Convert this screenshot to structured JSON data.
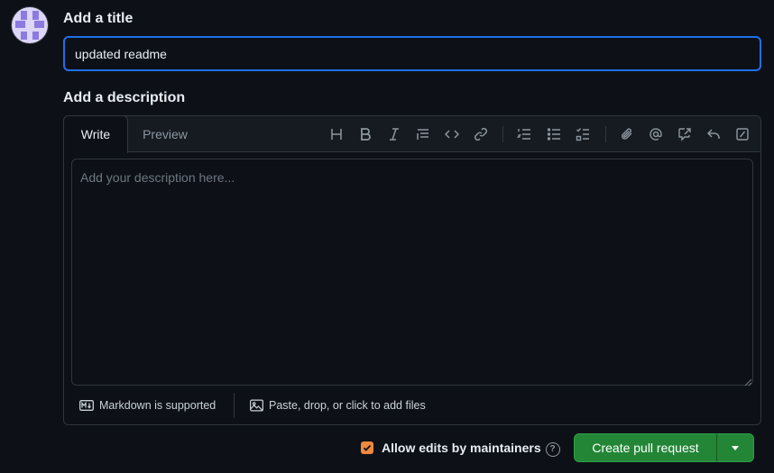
{
  "user": {
    "avatar_icon": "identicon-avatar"
  },
  "title_section": {
    "label": "Add a title",
    "value": "updated readme"
  },
  "description_section": {
    "label": "Add a description",
    "tabs": [
      {
        "label": "Write",
        "active": true
      },
      {
        "label": "Preview",
        "active": false
      }
    ],
    "toolbar_icons": [
      "heading-icon",
      "bold-icon",
      "italic-icon",
      "quote-icon",
      "code-icon",
      "link-icon",
      "numbered-list-icon",
      "unordered-list-icon",
      "task-list-icon",
      "attach-file-icon",
      "mention-icon",
      "cross-reference-icon",
      "saved-replies-icon",
      "slash-commands-icon"
    ],
    "placeholder": "Add your description here...",
    "footer": {
      "markdown": "Markdown is supported",
      "attach": "Paste, drop, or click to add files"
    }
  },
  "actions": {
    "allow_edits_label": "Allow edits by maintainers",
    "allow_edits_checked": true,
    "help_glyph": "?",
    "create_label": "Create pull request"
  },
  "colors": {
    "background": "#0d1117",
    "focus_border": "#1f6feb",
    "primary_button": "#238636",
    "checkbox": "#f0883e"
  }
}
